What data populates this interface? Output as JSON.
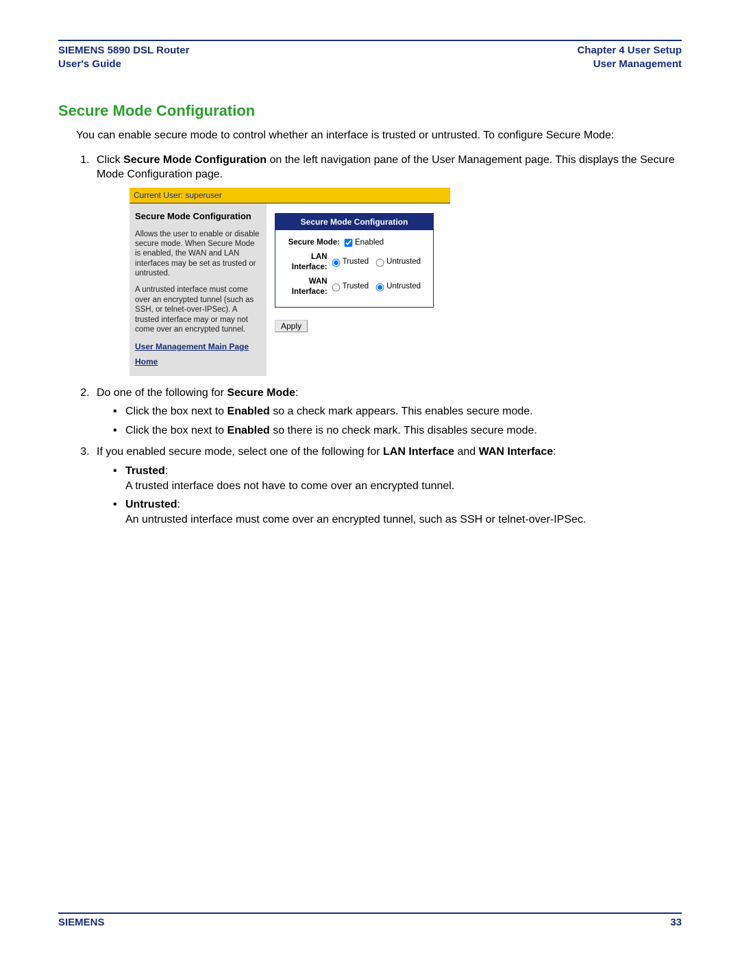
{
  "header": {
    "left1": "SIEMENS 5890 DSL Router",
    "left2": "User's Guide",
    "right1": "Chapter 4  User Setup",
    "right2": "User Management"
  },
  "section_title": "Secure Mode Configuration",
  "intro": "You can enable secure mode to control whether an interface is trusted or untrusted. To configure Secure Mode:",
  "steps": {
    "s1_pre": "Click ",
    "s1_bold": "Secure Mode Configuration",
    "s1_post": " on the left navigation pane of the User Management page. This displays the Secure Mode Configuration page.",
    "s2_pre": "Do one of the following for ",
    "s2_bold": "Secure Mode",
    "s2_post": ":",
    "s2_a_pre": "Click the box next to ",
    "s2_a_bold": "Enabled",
    "s2_a_post": " so a check mark appears. This enables secure mode.",
    "s2_b_pre": "Click the box next to ",
    "s2_b_bold": "Enabled",
    "s2_b_post": " so there is no check mark. This disables secure mode.",
    "s3_pre": "If you enabled secure mode, select one of the following for ",
    "s3_bold1": "LAN Interface",
    "s3_mid": " and ",
    "s3_bold2": "WAN Interface",
    "s3_post": ":",
    "s3_a_label": "Trusted",
    "s3_a_text": "A trusted interface does not have to come over an encrypted tunnel.",
    "s3_b_label": "Untrusted",
    "s3_b_text": "An untrusted interface must come over an encrypted tunnel, such as SSH or telnet-over-IPSec."
  },
  "mock": {
    "userbar": "Current User: superuser",
    "left_title": "Secure Mode Configuration",
    "left_p1": "Allows the user to enable or disable secure mode. When Secure Mode is enabled, the WAN and LAN interfaces may be set as trusted or untrusted.",
    "left_p2": "A untrusted interface must come over an encrypted tunnel (such as SSH, or telnet-over-IPSec). A trusted interface may or may not come over an encrypted tunnel.",
    "link1": "User Management Main Page",
    "link2": "Home",
    "box_head": "Secure Mode Configuration",
    "row1_label": "Secure Mode:",
    "row1_opt": "Enabled",
    "row2_label": "LAN Interface:",
    "row3_label": "WAN Interface:",
    "trusted": "Trusted",
    "untrusted": "Untrusted",
    "apply": "Apply"
  },
  "footer": {
    "left": "SIEMENS",
    "right": "33"
  }
}
